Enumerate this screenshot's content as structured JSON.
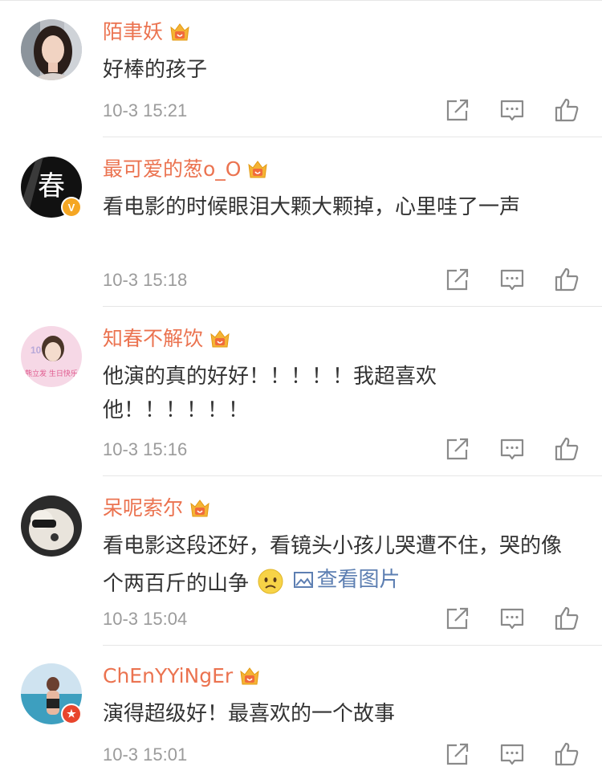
{
  "comments": [
    {
      "username": "陌聿妖",
      "text": "好棒的孩子",
      "time": "10-3 15:21",
      "avatar_icon": "woman-portrait-icon"
    },
    {
      "username": "最可爱的葱o_O",
      "text": "看电影的时候眼泪大颗大颗掉，心里哇了一声",
      "time": "10-3 15:18",
      "avatar_icon": "calligraphy-chun-icon",
      "avatar_text": "春"
    },
    {
      "username": "知春不解饮",
      "text": "他演的真的好好！！！！！我超喜欢他！！！！！！",
      "time": "10-3 15:16",
      "avatar_icon": "fan-photo-icon",
      "avatar_text": "熊立发 生日快乐"
    },
    {
      "username": "呆呢索尔",
      "text": "看电影这段还好，看镜头小孩儿哭遭不住，哭的像个两百斤的山争",
      "time": "10-3 15:04",
      "link_text": "查看图片",
      "avatar_icon": "dog-sunglasses-icon"
    },
    {
      "username": "ChEnYYiNgEr",
      "text": "演得超级好！最喜欢的一个故事",
      "time": "10-3 15:01",
      "avatar_icon": "beach-photo-icon"
    }
  ],
  "colors": {
    "username": "#eb7350",
    "text": "#333333",
    "time": "#9b9b9b",
    "link": "#5d7fb2",
    "divider": "#e6e6e6"
  }
}
